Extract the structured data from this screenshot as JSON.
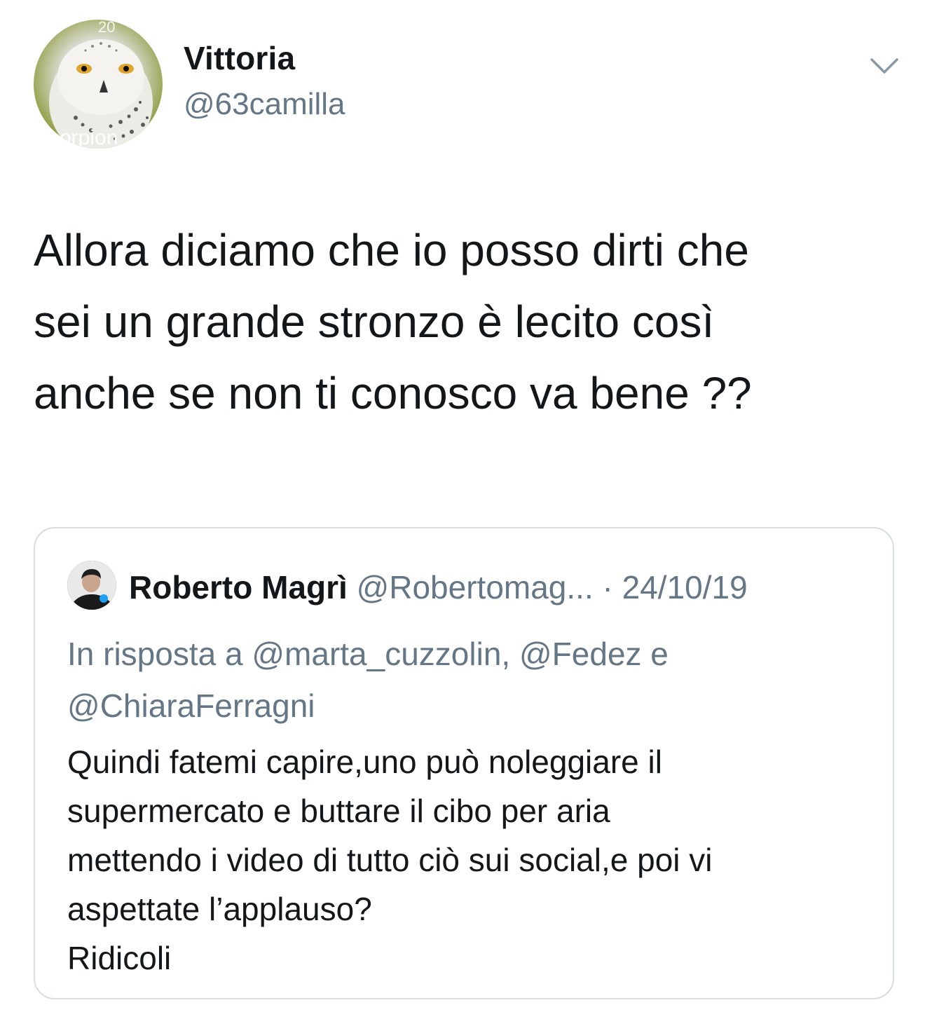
{
  "tweet": {
    "author": {
      "display_name": "Vittoria",
      "handle": "@63camilla",
      "avatar_overlay_text_top": "20",
      "avatar_overlay_text_bottom": "corpion"
    },
    "menu_icon": "chevron-down-icon",
    "text": "Allora diciamo che io posso dirti che\nsei un grande stronzo è lecito così\nanche se non ti conosco va bene ??"
  },
  "quoted_tweet": {
    "author": {
      "display_name": "Roberto Magrì",
      "handle": "@Robertomag...",
      "verified_icon": "verified-badge-icon"
    },
    "separator": " · ",
    "date": "24/10/19",
    "reply_prefix": "In risposta a ",
    "reply_mentions": [
      "@marta_cuzzolin",
      "@Fedez",
      "@ChiaraFerragni"
    ],
    "reply_sep_1": ", ",
    "reply_sep_2": " e ",
    "text": "Quindi fatemi capire,uno può noleggiare il\nsupermercato e buttare il cibo per aria\nmettendo i video di tutto ciò sui social,e poi vi\naspettate l’applauso?\nRidicoli"
  },
  "colors": {
    "text_primary": "#14171a",
    "text_secondary": "#657786",
    "border": "#d6dde3",
    "verified_blue": "#1da1f2"
  }
}
